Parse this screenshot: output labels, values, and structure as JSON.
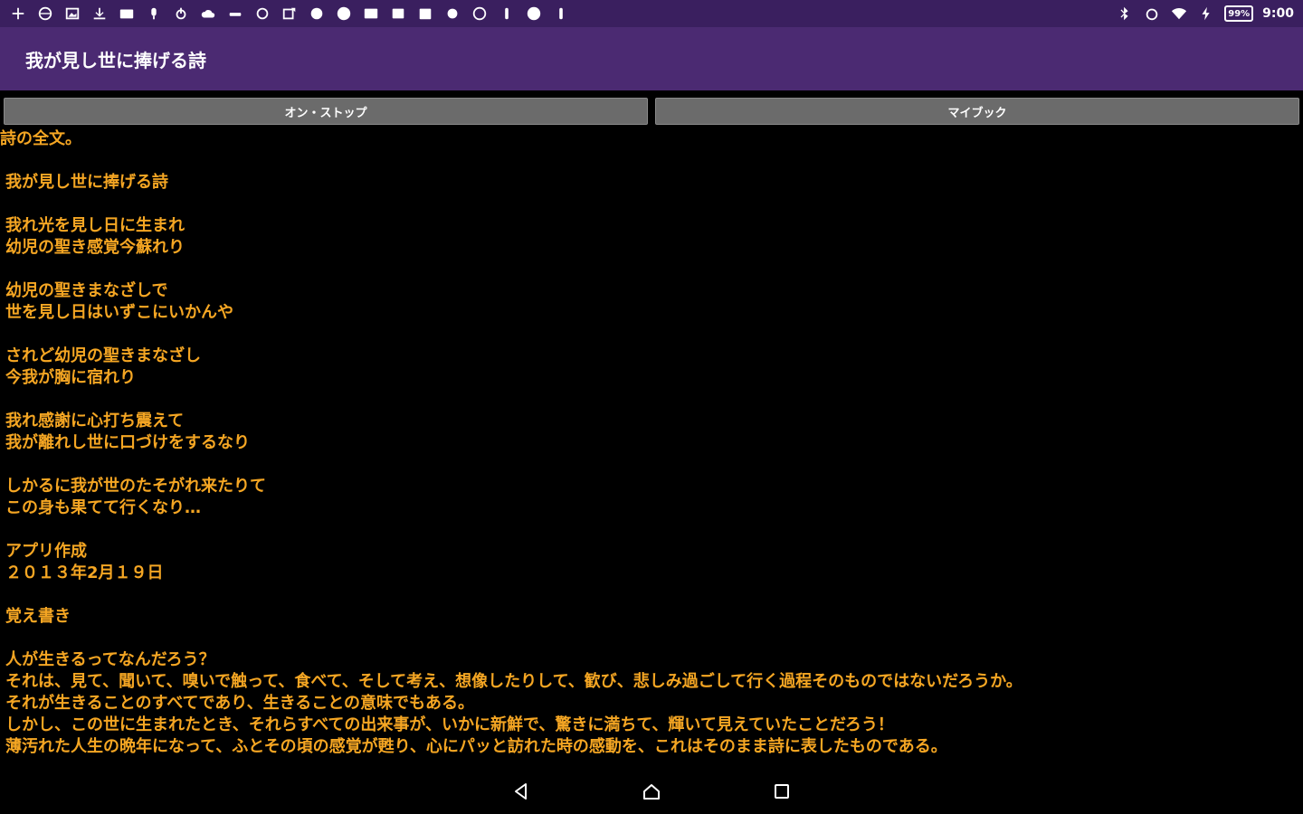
{
  "status_bar": {
    "left_icons": [
      "plus-icon",
      "globe-icon",
      "image-icon",
      "download-icon",
      "mail-icon",
      "mic-icon",
      "power-icon",
      "cloud-icon",
      "bar-icon",
      "refresh-icon",
      "share-icon",
      "spark-icon",
      "plus-circle-icon",
      "keyboard-icon",
      "grid-icon",
      "calendar-icon",
      "circle-icon",
      "compass-icon",
      "tap-icon",
      "alert-icon",
      "exclaim-icon"
    ],
    "right_icons": [
      "bluetooth-icon",
      "alarm-icon",
      "wifi-icon",
      "charging-icon"
    ],
    "battery": "99%",
    "time": "9:00"
  },
  "app": {
    "title": "我が見し世に捧げる詩"
  },
  "buttons": {
    "on_stop": "オン・ストップ",
    "my_book": "マイブック"
  },
  "content": {
    "lines": [
      "詩の全文。",
      "",
      "我が見し世に捧げる詩",
      "",
      "我れ光を見し日に生まれ",
      "幼児の聖き感覚今蘇れり",
      "",
      "幼児の聖きまなざしで",
      "世を見し日はいずこにいかんや",
      "",
      "されど幼児の聖きまなざし",
      "今我が胸に宿れり",
      "",
      "我れ感謝に心打ち震えて",
      "我が離れし世に口づけをするなり",
      "",
      "しかるに我が世のたそがれ来たりて",
      "この身も果てて行くなり…",
      "",
      "アプリ作成",
      "２０１３年2月１９日",
      "",
      "覚え書き",
      "",
      "人が生きるってなんだろう？",
      "それは、見て、聞いて、嗅いで触って、食べて、そして考え、想像したりして、歓び、悲しみ過ごして行く過程そのものではないだろうか。",
      "それが生きることのすべてであり、生きることの意味でもある。",
      "しかし、この世に生まれたとき、それらすべての出来事が、いかに新鮮で、驚きに満ちて、輝いて見えていたことだろう！",
      "薄汚れた人生の晩年になって、ふとその頃の感覚が甦り、心にパッと訪れた時の感動を、これはそのまま詩に表したものである。"
    ]
  },
  "nav": {
    "back": "back-icon",
    "home": "home-icon",
    "recents": "recents-icon"
  },
  "colors": {
    "status_bar": "#3a1f5f",
    "app_bar": "#4b2a72",
    "text": "#f5a623",
    "background": "#000000",
    "button": "#6b6b6b"
  }
}
